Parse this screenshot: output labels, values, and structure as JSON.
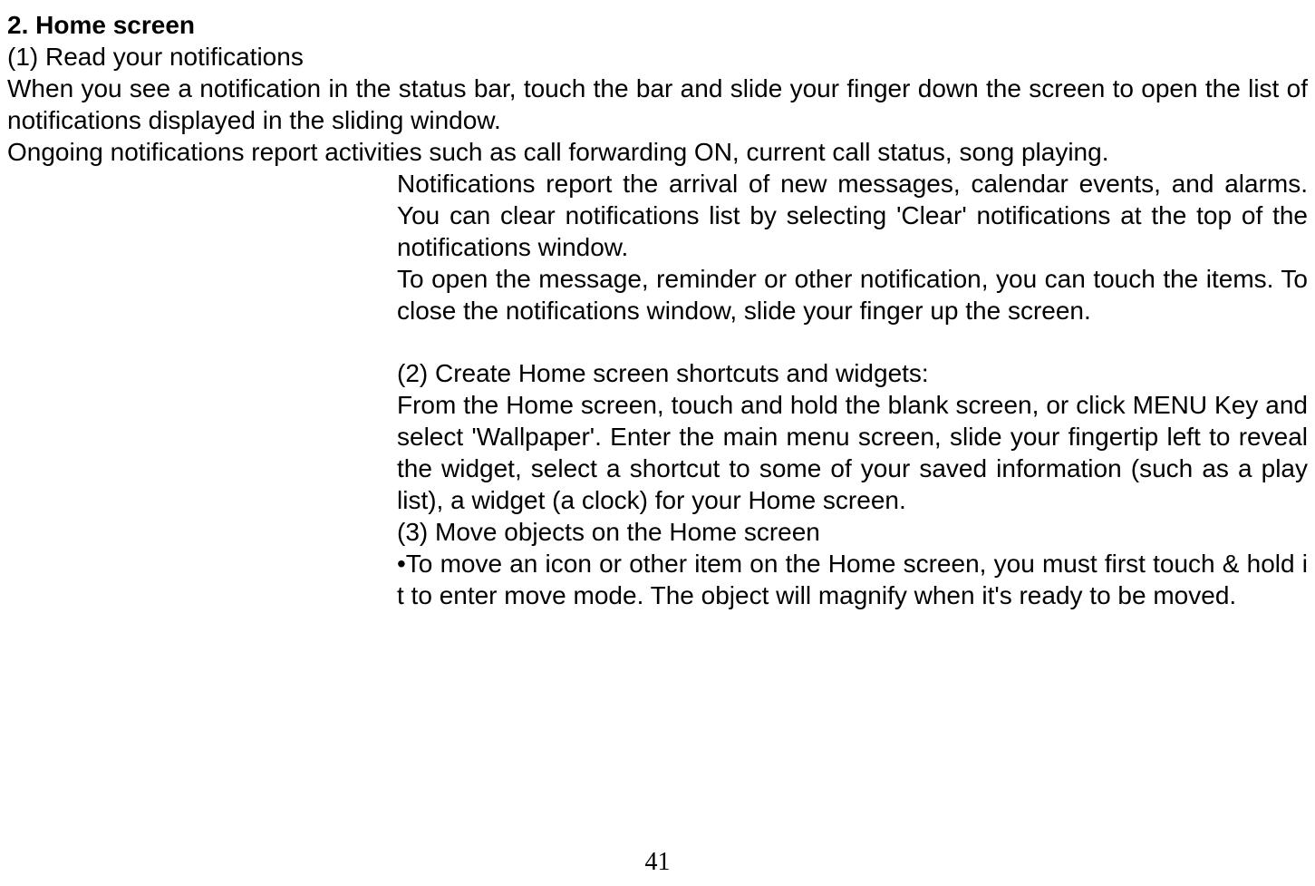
{
  "heading": "2. Home screen",
  "section1_title": "(1) Read your notifications",
  "para1": "When you see a notification in the status bar, touch the bar and slide your finger down the screen to open the list of notifications displayed in the sliding window.",
  "para2": "Ongoing notifications report activities such as call forwarding ON, current call status, song playing.",
  "para3": "Notifications report the arrival of new messages, calendar events, and alarms. You can clear notifications list by selecting 'Clear' notifications at the top of the notifications window.",
  "para4": "To open the message, reminder or other notification, you can touch the items. To close the notifications window, slide your finger up the screen.",
  "section2_title": "(2) Create Home screen shortcuts and widgets:",
  "para5": "From the Home screen, touch and hold the blank screen, or click MENU Key and select 'Wallpaper'. Enter the main menu screen, slide your fingertip left to reveal the widget, select a shortcut to some of your saved information (such as a play list), a widget (a clock) for your Home screen.",
  "section3_title": "(3) Move objects on the Home screen",
  "para6": "•To move an icon or other item on the Home screen, you must first touch & hold i t to enter move mode. The object will magnify when it's ready to be moved.",
  "page_number": "41"
}
